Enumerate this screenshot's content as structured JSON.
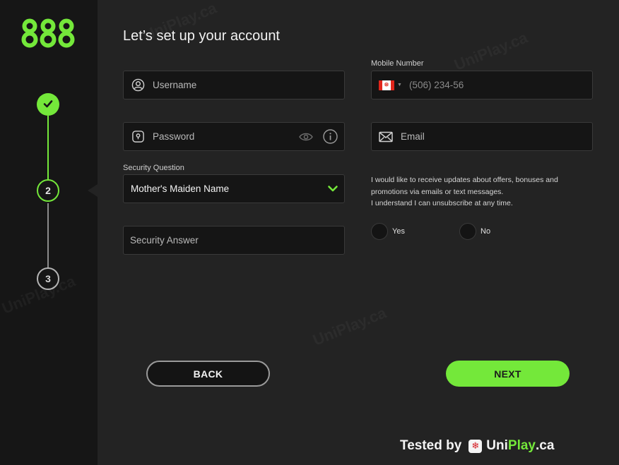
{
  "brand": {
    "logo_text": "888",
    "accent": "#74e83a"
  },
  "page": {
    "title": "Let’s set up your account"
  },
  "steps": [
    {
      "label": "",
      "state": "complete"
    },
    {
      "label": "2",
      "state": "current"
    },
    {
      "label": "3",
      "state": "upcoming"
    }
  ],
  "form": {
    "username": {
      "placeholder": "Username",
      "icon": "user-icon"
    },
    "password": {
      "placeholder": "Password",
      "icon": "lock-icon"
    },
    "security_question": {
      "label": "Security Question",
      "value": "Mother's Maiden Name"
    },
    "security_answer": {
      "placeholder": "Security Answer"
    },
    "mobile": {
      "label": "Mobile Number",
      "placeholder": "(506) 234-56",
      "flag": "canada-flag-icon"
    },
    "email": {
      "placeholder": "Email",
      "icon": "envelope-icon"
    },
    "consent": {
      "line1": "I would like to receive updates about offers, bonuses and",
      "line2": "promotions via emails or text messages.",
      "line3": "I understand I can unsubscribe at any time.",
      "yes_label": "Yes",
      "no_label": "No"
    }
  },
  "buttons": {
    "back": "BACK",
    "next": "NEXT"
  },
  "footer": {
    "tested_by": "Tested by",
    "brand_part1": "Uni",
    "brand_part2": "Play",
    "brand_part3": ".ca"
  },
  "watermark": "UniPlay.ca"
}
